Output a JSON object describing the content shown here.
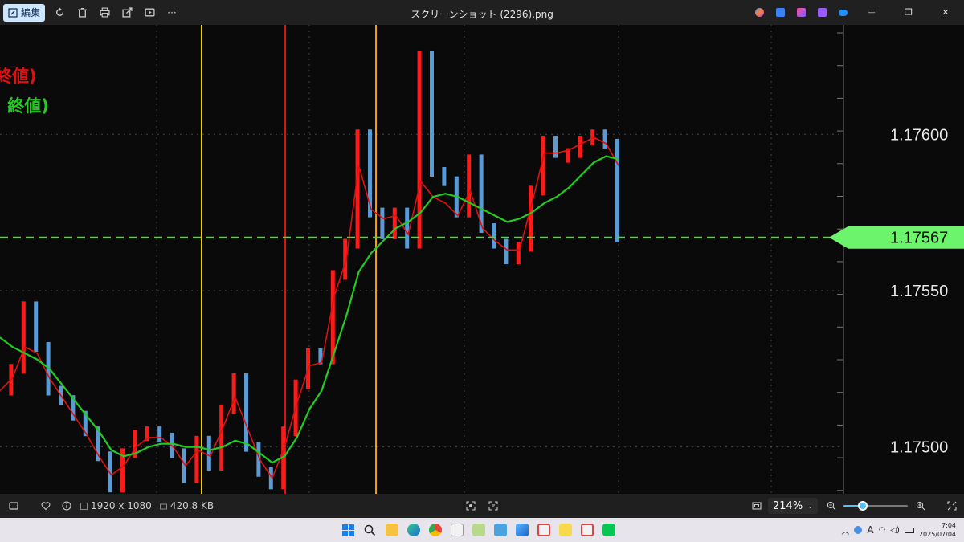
{
  "window": {
    "title": "スクリーンショット (2296).png",
    "edit_label": "編集",
    "toolbar_icons": [
      "rotate-icon",
      "delete-icon",
      "print-icon",
      "share-icon",
      "slideshow-icon",
      "more-icon"
    ],
    "more_label": "···",
    "minimize_glyph": "—",
    "restore_glyph": "❐",
    "close_glyph": "✕"
  },
  "chart": {
    "legend_red": "終値)",
    "legend_green": ", 終値)",
    "price_labels": [
      "1.17600",
      "1.17550",
      "1.17500"
    ],
    "current_price": "1.17567",
    "colors": {
      "background": "#0a0a0a",
      "up_candle": "#ff1a1a",
      "down_candle": "#5b9bd5",
      "ma_fast": "#e01010",
      "ma_slow": "#22cc22",
      "current_price_line": "#4cd94c",
      "vline_yellow": "#f2d200",
      "vline_red": "#e01010",
      "vline_orange": "#f0a000"
    }
  },
  "chart_data": {
    "type": "line",
    "title": "",
    "ylabel": "",
    "xlabel": "",
    "ylim": [
      1.17485,
      1.17635
    ],
    "y_ticks": [
      1.176,
      1.1755,
      1.175
    ],
    "current_price": 1.17567,
    "series": [
      {
        "kind": "price",
        "values": [
          1.17518,
          1.17525,
          1.17545,
          1.17532,
          1.17518,
          1.17515,
          1.1751,
          1.17505,
          1.17497,
          1.17487,
          1.17498,
          1.17504,
          1.17505,
          1.17503,
          1.17498,
          1.1749,
          1.17502,
          1.17494,
          1.17512,
          1.17522,
          1.175,
          1.17492,
          1.17488,
          1.17505,
          1.1752,
          1.1753,
          1.17528,
          1.17555,
          1.17565,
          1.176,
          1.17575,
          1.17568,
          1.17575,
          1.17565,
          1.17625,
          1.17588,
          1.17585,
          1.17575,
          1.17592,
          1.1757,
          1.17565,
          1.1756,
          1.17564,
          1.17582,
          1.17598,
          1.17594,
          1.17594,
          1.17598,
          1.176,
          1.17597,
          1.17567
        ]
      },
      {
        "kind": "ma_fast",
        "values": [
          1.17518,
          1.17522,
          1.17532,
          1.1753,
          1.17522,
          1.17516,
          1.1751,
          1.17504,
          1.17497,
          1.17491,
          1.17494,
          1.175,
          1.17503,
          1.17503,
          1.175,
          1.17494,
          1.17499,
          1.17497,
          1.17506,
          1.17516,
          1.17506,
          1.17496,
          1.1749,
          1.175,
          1.17514,
          1.17526,
          1.17527,
          1.17548,
          1.1756,
          1.1759,
          1.17576,
          1.17573,
          1.17574,
          1.17568,
          1.17585,
          1.1758,
          1.17578,
          1.17574,
          1.17582,
          1.1757,
          1.17566,
          1.17563,
          1.17563,
          1.17578,
          1.17594,
          1.17594,
          1.17595,
          1.17597,
          1.17599,
          1.17597,
          1.1759
        ]
      },
      {
        "kind": "ma_slow",
        "values": [
          1.17535,
          1.17532,
          1.1753,
          1.17528,
          1.17525,
          1.1752,
          1.17515,
          1.1751,
          1.17505,
          1.17499,
          1.17497,
          1.17498,
          1.175,
          1.17501,
          1.17501,
          1.175,
          1.175,
          1.17499,
          1.175,
          1.17502,
          1.17501,
          1.17498,
          1.17495,
          1.17497,
          1.17503,
          1.17512,
          1.17518,
          1.1753,
          1.17542,
          1.17556,
          1.17562,
          1.17566,
          1.1757,
          1.17572,
          1.17575,
          1.1758,
          1.17581,
          1.1758,
          1.17578,
          1.17576,
          1.17574,
          1.17572,
          1.17573,
          1.17575,
          1.17578,
          1.1758,
          1.17583,
          1.17587,
          1.17591,
          1.17593,
          1.17592
        ]
      }
    ]
  },
  "statusbar": {
    "dimensions": "1920 x 1080",
    "filesize": "420.8 KB",
    "zoom": "214%",
    "zoom_level": 0.3
  },
  "taskbar": {
    "time": "7:04",
    "date": "2025/07/04",
    "ime": "A"
  }
}
